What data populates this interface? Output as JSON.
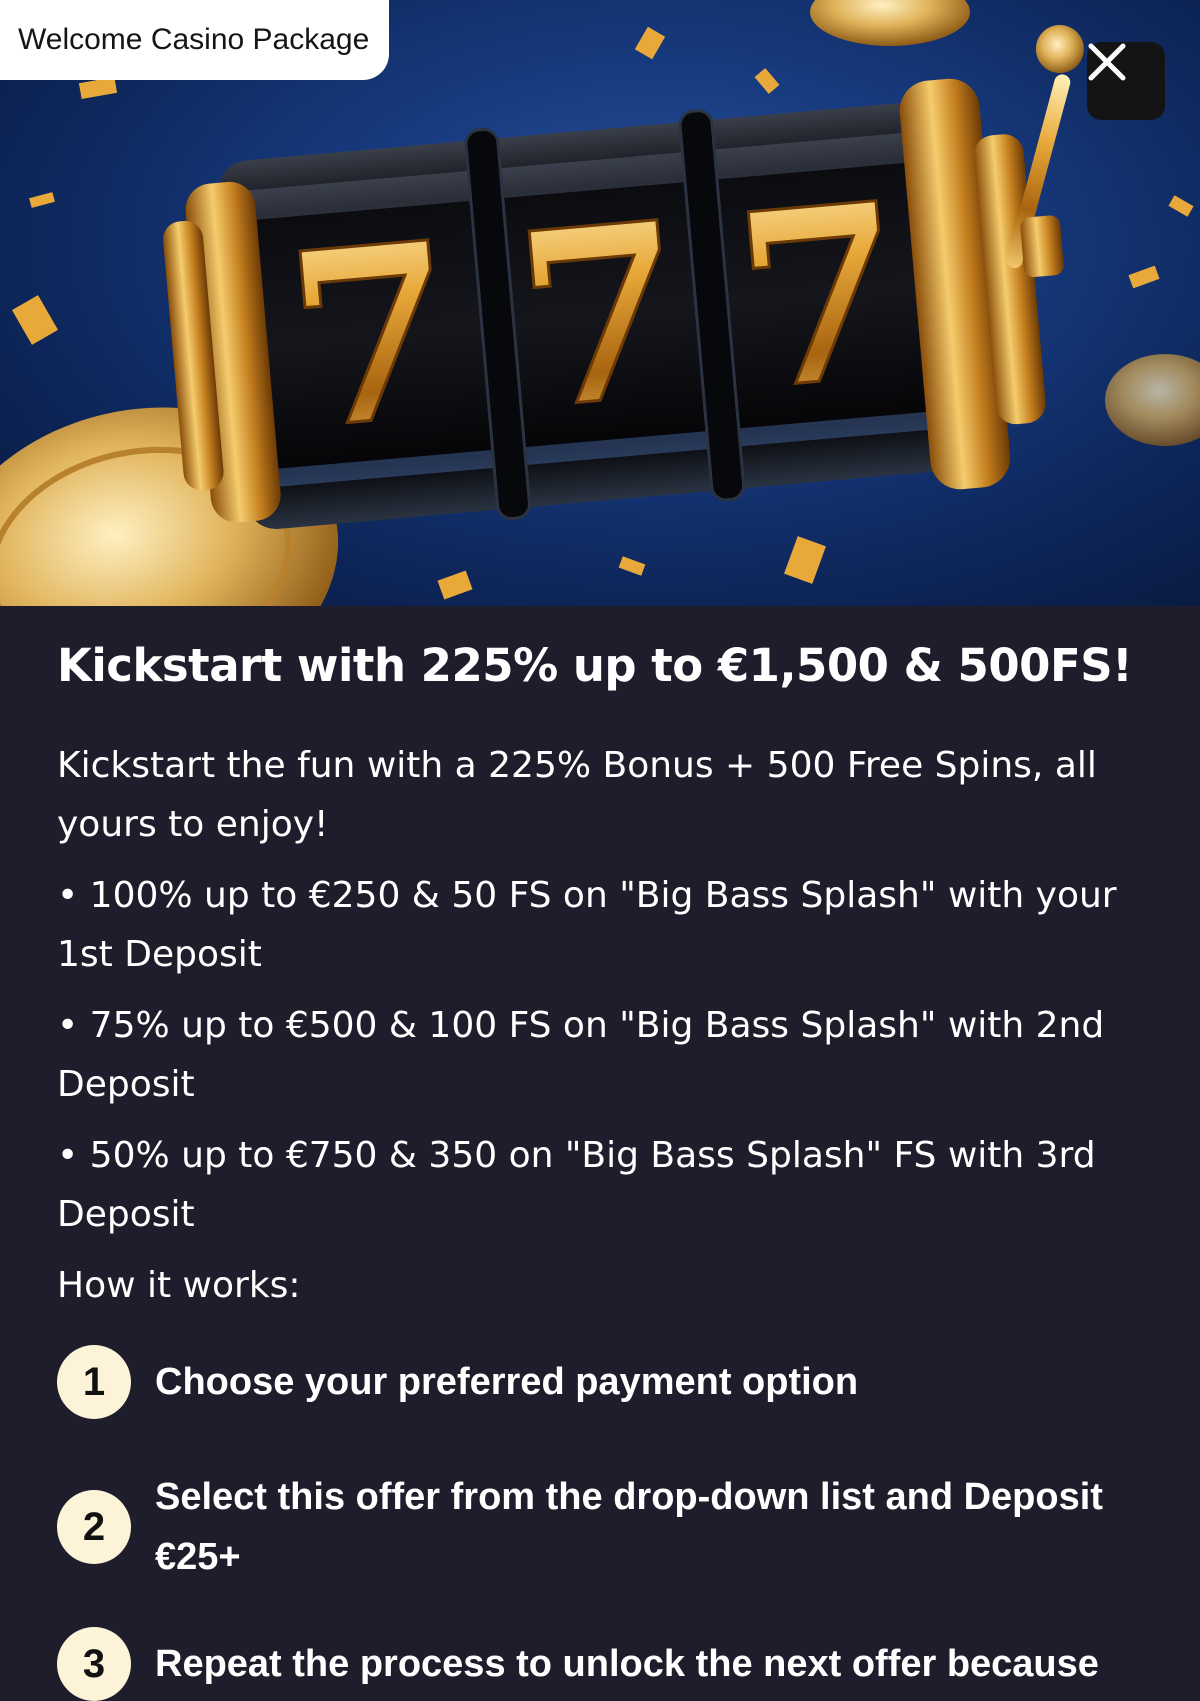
{
  "hero": {
    "tag_label": "Welcome Casino Package",
    "reel_digits": [
      "7",
      "7",
      "7"
    ],
    "close_icon": "close-icon"
  },
  "offer": {
    "title": "Kickstart with 225% up to €1,500 & 500FS!",
    "intro": "Kickstart the fun with a 225% Bonus + 500 Free Spins, all yours to enjoy!",
    "bullets": [
      "• 100% up to €250 & 50 FS on \"Big Bass Splash\" with your 1st Deposit",
      "• 75% up to €500 & 100  FS on \"Big Bass Splash\" with 2nd Deposit",
      "• 50% up to €750 & 350 on \"Big Bass Splash\" FS with 3rd Deposit"
    ],
    "how_label": "How it works:"
  },
  "steps": [
    {
      "number": "1",
      "text": "Choose your preferred payment option"
    },
    {
      "number": "2",
      "text": "Select this offer from the drop-down list and Deposit €25+"
    },
    {
      "number": "3",
      "text": "Repeat the process to unlock the next offer because"
    }
  ],
  "colors": {
    "background": "#1e1d2b",
    "step_circle": "#fdf3d8",
    "gold": "#e8a93a"
  }
}
